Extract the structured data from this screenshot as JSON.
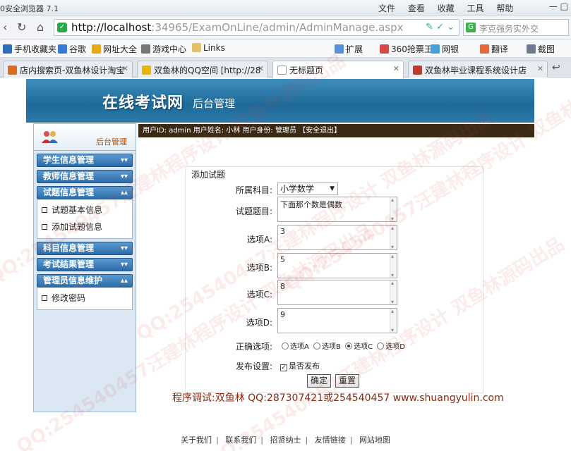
{
  "browser": {
    "app_title": "0安全浏览器 7.1",
    "menus": [
      "文件",
      "查看",
      "收藏",
      "工具",
      "帮助"
    ],
    "url_host": "http://localhost",
    "url_rest": ":34965/ExamOnLine/admin/AdminManage.aspx",
    "search_placeholder": "李克强务实外交",
    "favorites": [
      "手机收藏夹",
      "谷歌",
      "网址大全",
      "游戏中心",
      "Links",
      "扩展",
      "360抢票王",
      "网银",
      "翻译",
      "截图"
    ],
    "tabs": [
      "店内搜索页-双鱼林设计淘宝",
      "双鱼林的QQ空间 [http://28",
      "无标题页",
      "双鱼林毕业课程系统设计店"
    ]
  },
  "header": {
    "logo": "在线考试网",
    "logo_sub": "后台管理",
    "userbar": "用户ID: admin  用户姓名: 小林  用户身份: 管理员 【安全退出】"
  },
  "sidebar": {
    "title": "后台管理",
    "groups": [
      {
        "label": "学生信息管理",
        "items": []
      },
      {
        "label": "教师信息管理",
        "items": []
      },
      {
        "label": "试题信息管理",
        "items": [
          "试题基本信息",
          "添加试题信息"
        ]
      },
      {
        "label": "科目信息管理",
        "items": []
      },
      {
        "label": "考试结果管理",
        "items": []
      },
      {
        "label": "管理员信息维护",
        "items": [
          "修改密码"
        ]
      }
    ]
  },
  "form": {
    "title": "添加试题",
    "subject_label": "所属科目:",
    "subject_value": "小学数学",
    "question_label": "试题题目:",
    "question_value": "下面那个数是偶数",
    "option_a_label": "选项A:",
    "option_a_value": "3",
    "option_b_label": "选项B:",
    "option_b_value": "5",
    "option_c_label": "选项C:",
    "option_c_value": "8",
    "option_d_label": "选项D:",
    "option_d_value": "9",
    "answer_label": "正确选项:",
    "answer_options": [
      "选项A",
      "选项B",
      "选项C",
      "选项D"
    ],
    "answer_selected": "选项C",
    "publish_label": "发布设置:",
    "publish_checkbox": "是否发布",
    "confirm_button": "确定",
    "reset_button": "重置"
  },
  "credit": "程序调试:双鱼林 QQ:287307421或254540457 www.shuangyulin.com",
  "footer_links": [
    "关于我们",
    "联系我们",
    "招贤纳士",
    "友情链接",
    "网站地图"
  ],
  "watermark": "QQ:254540457汪建林程序设计 双鱼林源码出品"
}
